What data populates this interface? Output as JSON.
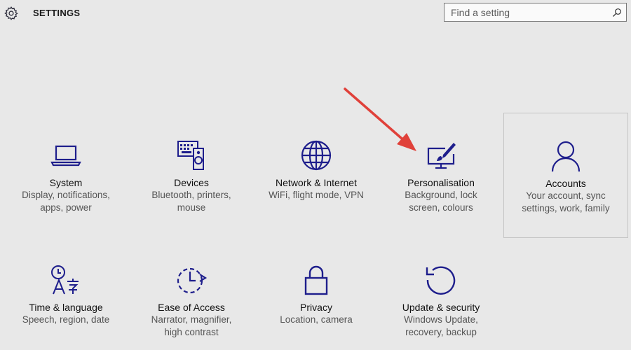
{
  "header": {
    "title": "SETTINGS",
    "search_placeholder": "Find a setting"
  },
  "tiles": [
    {
      "name": "System",
      "desc1": "Display, notifications,",
      "desc2": "apps, power",
      "icon": "laptop-icon"
    },
    {
      "name": "Devices",
      "desc1": "Bluetooth, printers,",
      "desc2": "mouse",
      "icon": "devices-icon"
    },
    {
      "name": "Network & Internet",
      "desc1": "WiFi, flight mode, VPN",
      "desc2": "",
      "icon": "globe-icon"
    },
    {
      "name": "Personalisation",
      "desc1": "Background, lock",
      "desc2": "screen, colours",
      "icon": "personalisation-icon"
    },
    {
      "name": "Accounts",
      "desc1": "Your account, sync",
      "desc2": "settings, work, family",
      "icon": "person-icon"
    },
    {
      "name": "Time & language",
      "desc1": "Speech, region, date",
      "desc2": "",
      "icon": "time-language-icon"
    },
    {
      "name": "Ease of Access",
      "desc1": "Narrator, magnifier,",
      "desc2": "high contrast",
      "icon": "ease-of-access-icon"
    },
    {
      "name": "Privacy",
      "desc1": "Location, camera",
      "desc2": "",
      "icon": "lock-icon"
    },
    {
      "name": "Update & security",
      "desc1": "Windows Update,",
      "desc2": "recovery, backup",
      "icon": "update-icon"
    }
  ],
  "colors": {
    "accent": "#1e1e8c",
    "annotation_arrow": "#e0413a",
    "background": "#e8e8e8"
  }
}
